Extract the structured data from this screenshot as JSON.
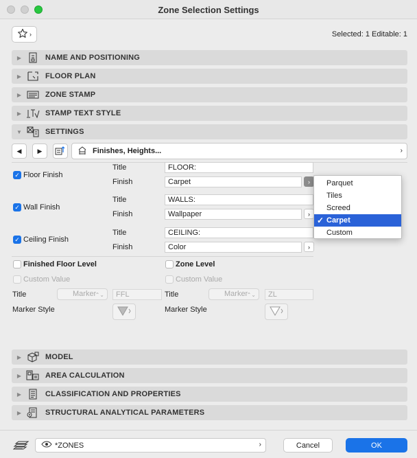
{
  "window": {
    "title": "Zone Selection Settings",
    "traffic_lights": [
      "#ff5f57",
      "#febc2e",
      "#28c840"
    ]
  },
  "toolbar": {
    "favorites_icon": "star-icon",
    "selection_info": "Selected: 1 Editable: 1"
  },
  "sections_top": [
    {
      "label": "NAME AND POSITIONING",
      "icon": "name-positioning-icon",
      "expanded": false
    },
    {
      "label": "FLOOR PLAN",
      "icon": "floor-plan-icon",
      "expanded": false
    },
    {
      "label": "ZONE STAMP",
      "icon": "zone-stamp-icon",
      "expanded": false
    },
    {
      "label": "STAMP TEXT STYLE",
      "icon": "text-style-icon",
      "expanded": false
    },
    {
      "label": "SETTINGS",
      "icon": "settings-icon",
      "expanded": true
    }
  ],
  "settings_nav": {
    "page_label": "Finishes, Heights..."
  },
  "finishes": [
    {
      "checkbox_label": "Floor Finish",
      "checked": true,
      "title_label": "Title",
      "title_value": "FLOOR:",
      "finish_label": "Finish",
      "finish_value": "Carpet"
    },
    {
      "checkbox_label": "Wall Finish",
      "checked": true,
      "title_label": "Title",
      "title_value": "WALLS:",
      "finish_label": "Finish",
      "finish_value": "Wallpaper"
    },
    {
      "checkbox_label": "Ceiling Finish",
      "checked": true,
      "title_label": "Title",
      "title_value": "CEILING:",
      "finish_label": "Finish",
      "finish_value": "Color"
    }
  ],
  "finish_dropdown": {
    "options": [
      "Parquet",
      "Tiles",
      "Screed",
      "Carpet",
      "Custom"
    ],
    "selected": "Carpet"
  },
  "levels": {
    "ffl": {
      "checkbox_label": "Finished Floor Level",
      "custom_value_label": "Custom Value",
      "title_label": "Title",
      "marker_value": "Marker",
      "title_placeholder": "FFL",
      "marker_style_label": "Marker Style"
    },
    "zone": {
      "checkbox_label": "Zone Level",
      "custom_value_label": "Custom Value",
      "title_label": "Title",
      "marker_value": "Marker",
      "title_placeholder": "ZL",
      "marker_style_label": "Marker Style"
    }
  },
  "sections_bottom": [
    {
      "label": "MODEL",
      "icon": "model-icon"
    },
    {
      "label": "AREA CALCULATION",
      "icon": "area-calculation-icon"
    },
    {
      "label": "CLASSIFICATION AND PROPERTIES",
      "icon": "classification-icon"
    },
    {
      "label": "STRUCTURAL ANALYTICAL PARAMETERS",
      "icon": "structural-icon"
    }
  ],
  "footer": {
    "layer_value": "*ZONES",
    "cancel_label": "Cancel",
    "ok_label": "OK"
  },
  "colors": {
    "accent": "#1a73e8",
    "menu_selected": "#2a62d8"
  }
}
